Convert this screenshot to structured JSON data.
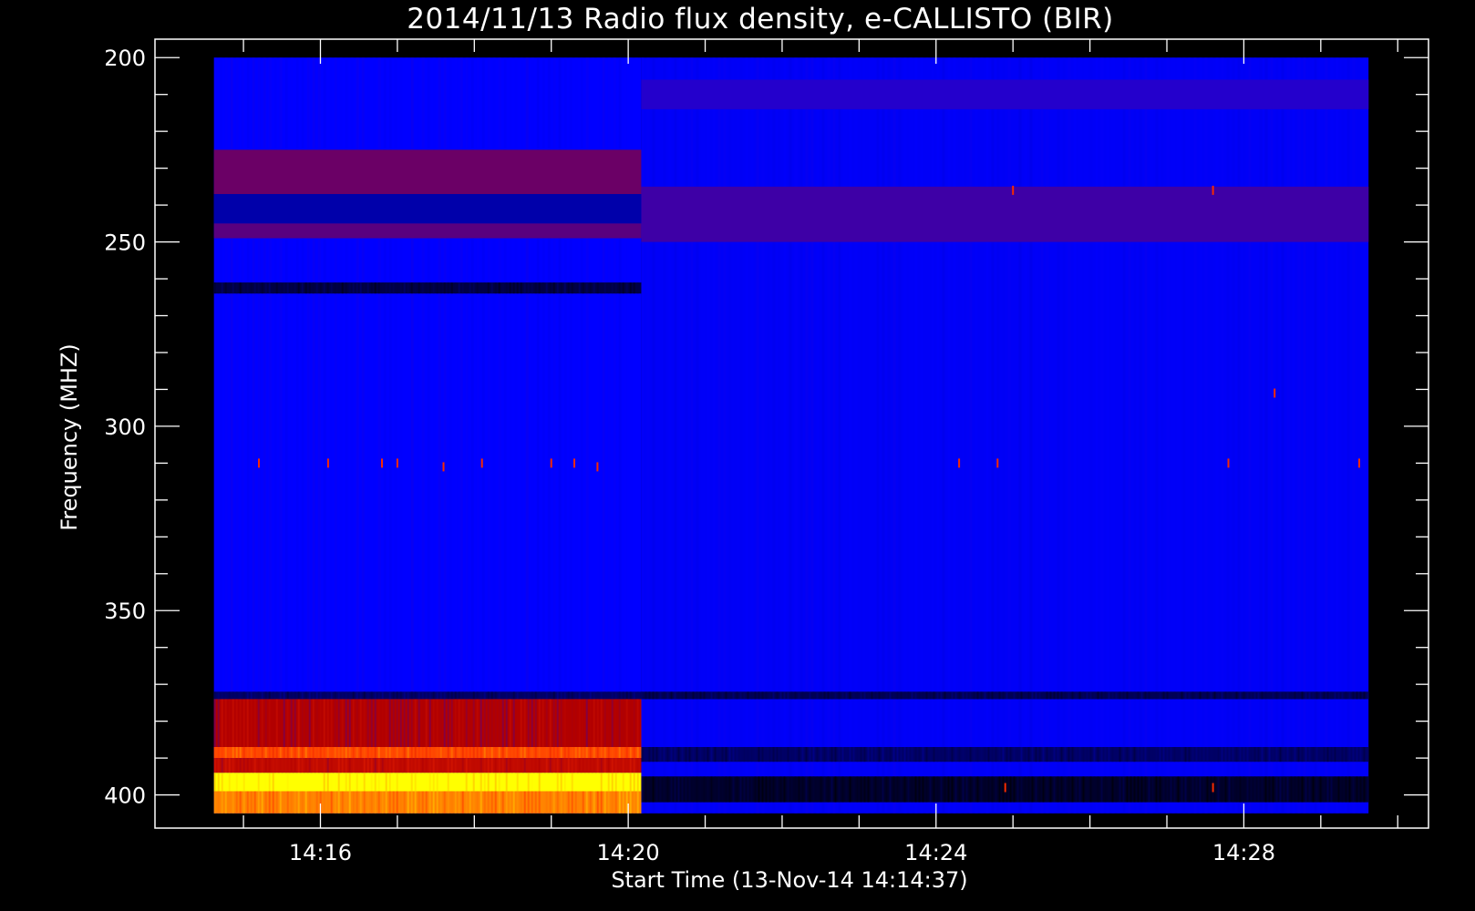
{
  "chart_data": {
    "type": "heatmap",
    "title": "2014/11/13  Radio flux density, e-CALLISTO (BIR)",
    "xlabel": "Start Time (13-Nov-14 14:14:37)",
    "ylabel": "Frequency (MHZ)",
    "x_tick_labels": [
      "14:16",
      "14:20",
      "14:24",
      "14:28"
    ],
    "x_ticks_min": [
      16,
      20,
      24,
      28
    ],
    "x_start_min": 14.617,
    "x_end_min": 29.62,
    "xlim_min": [
      13.85,
      30.4
    ],
    "y_ticks": [
      200,
      250,
      300,
      350,
      400
    ],
    "ylim": [
      195,
      409
    ],
    "data_freq_range": [
      200,
      405
    ],
    "colormap": [
      "#000000",
      "#0000ff",
      "#b20000",
      "#ff3000",
      "#ffff00"
    ],
    "background_color": "#000000",
    "grid": false,
    "regime_change_min": 20.17,
    "segments": [
      {
        "time_range_min": [
          14.617,
          20.17
        ],
        "base_level": 0.3,
        "bands": [
          {
            "freq": [
              225,
              237
            ],
            "level": 0.42
          },
          {
            "freq": [
              237,
              245
            ],
            "level": 0.2
          },
          {
            "freq": [
              245,
              249
            ],
            "level": 0.4
          },
          {
            "freq": [
              261,
              264
            ],
            "level": 0.08
          },
          {
            "freq": [
              372,
              374
            ],
            "level": 0.12
          },
          {
            "freq": [
              374,
              387
            ],
            "level": 0.5
          },
          {
            "freq": [
              387,
              390
            ],
            "level": 0.78
          },
          {
            "freq": [
              390,
              394
            ],
            "level": 0.55
          },
          {
            "freq": [
              394,
              399
            ],
            "level": 1.0
          },
          {
            "freq": [
              399,
              405
            ],
            "level": 0.85
          }
        ]
      },
      {
        "time_range_min": [
          20.17,
          29.62
        ],
        "base_level": 0.29,
        "bands": [
          {
            "freq": [
              206,
              214
            ],
            "level": 0.34
          },
          {
            "freq": [
              235,
              250
            ],
            "level": 0.37
          },
          {
            "freq": [
              372,
              374
            ],
            "level": 0.1
          },
          {
            "freq": [
              387,
              391
            ],
            "level": 0.12
          },
          {
            "freq": [
              395,
              402
            ],
            "level": 0.05
          }
        ]
      }
    ],
    "spikes": [
      {
        "time_min": 15.2,
        "freq": 310
      },
      {
        "time_min": 16.1,
        "freq": 310
      },
      {
        "time_min": 16.8,
        "freq": 310
      },
      {
        "time_min": 17.0,
        "freq": 310
      },
      {
        "time_min": 17.6,
        "freq": 311
      },
      {
        "time_min": 18.1,
        "freq": 310
      },
      {
        "time_min": 19.0,
        "freq": 310
      },
      {
        "time_min": 19.3,
        "freq": 310
      },
      {
        "time_min": 19.6,
        "freq": 311
      },
      {
        "time_min": 24.3,
        "freq": 310
      },
      {
        "time_min": 24.8,
        "freq": 310
      },
      {
        "time_min": 27.8,
        "freq": 310
      },
      {
        "time_min": 29.5,
        "freq": 310
      },
      {
        "time_min": 25.0,
        "freq": 236
      },
      {
        "time_min": 27.6,
        "freq": 236
      },
      {
        "time_min": 28.4,
        "freq": 291
      },
      {
        "time_min": 24.9,
        "freq": 398
      },
      {
        "time_min": 27.6,
        "freq": 398
      }
    ]
  }
}
